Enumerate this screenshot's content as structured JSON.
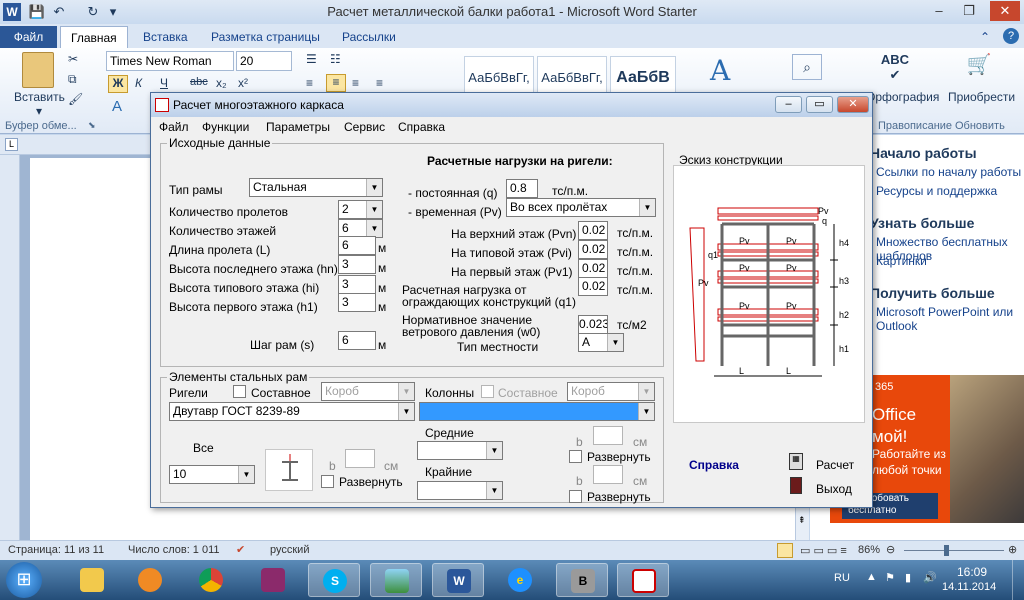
{
  "word": {
    "title": "Расчет металлической балки работа1  -  Microsoft Word Starter",
    "tabs": [
      "Файл",
      "Главная",
      "Вставка",
      "Разметка страницы",
      "Рассылки"
    ],
    "font_name": "Times New Roman",
    "font_size": "20",
    "format_buttons": [
      "Ж",
      "К",
      "Ч",
      "abc",
      "x₂",
      "x²"
    ],
    "styles": [
      "АаБбВвГг,",
      "АаБбВвГг,",
      "АаБбВ"
    ],
    "paste_label": "Вставить",
    "spelling_label": "Орфография",
    "buy_label": "Приобрести",
    "groups": [
      "Буфер обме...",
      "Правописание",
      "Обновить"
    ],
    "status": {
      "page": "Страница: 11 из 11",
      "words": "Число слов: 1 011",
      "lang": "русский",
      "zoom": "86%"
    },
    "panel": {
      "h1": "Начало работы",
      "l1": "Ссылки по началу работы",
      "l2": "Ресурсы и поддержка",
      "h2": "Узнать больше",
      "l3": "Множество бесплатных шаблонов",
      "l4": "Картинки",
      "h3": "Получить больше",
      "l5": "Microsoft PowerPoint или Outlook",
      "ad_year": "365",
      "ad_line1": "Office",
      "ad_line2": "мой!",
      "ad_line3": "Работайте из",
      "ad_line4": "любой точки",
      "ad_btn1": "Попробовать",
      "ad_btn2": "бесплатно"
    }
  },
  "taskbar": {
    "lang": "RU",
    "time": "16:09",
    "date": "14.11.2014"
  },
  "dialog": {
    "title": "Расчет многоэтажного каркаса",
    "menu": [
      "Файл",
      "Функции",
      "Параметры",
      "Сервис",
      "Справка"
    ],
    "input_group": "Исходные данные",
    "frame_type_label": "Тип рамы",
    "frame_type": "Стальная",
    "spans_label": "Количество пролетов",
    "spans": "2",
    "floors_label": "Количество этажей",
    "floors": "6",
    "span_len_label": "Длина пролета (L)",
    "span_len": "6",
    "top_height_label": "Высота последнего этажа (hn)",
    "top_height": "3",
    "typ_height_label": "Высота типового этажа (hi)",
    "typ_height": "3",
    "first_height_label": "Высота первого этажа (h1)",
    "first_height": "3",
    "step_label": "Шаг рам (s)",
    "step": "6",
    "unit_m": "м",
    "loads_title": "Расчетные нагрузки на ригели:",
    "perm_label": "- постоянная (q)",
    "perm": "0.8",
    "perm_unit": "тс/п.м.",
    "temp_label": "- временная (Pv)",
    "temp": "Во всех пролётах",
    "pvn_label": "На верхний этаж (Pvn)",
    "pvn": "0.02",
    "pvi_label": "На типовой этаж (Pvi)",
    "pvi": "0.02",
    "pv1_label": "На первый этаж (Pv1)",
    "pv1": "0.02",
    "tspm": "тс/п.м.",
    "q1_label1": "Расчетная нагрузка от",
    "q1_label2": "ограждающих конструкций (q1)",
    "q1": "0.02",
    "w0_label1": "Нормативное значение",
    "w0_label2": "ветрового давления (w0)",
    "w0": "0.023",
    "w0_unit": "тс/м2",
    "terrain_label": "Тип местности",
    "terrain": "A",
    "sketch_label": "Эскиз конструкции",
    "elements_group": "Элементы стальных рам",
    "beams_label": "Ригели",
    "composite_label": "Составное",
    "box_label": "Короб",
    "columns_label": "Колонны",
    "beam_profile": "Двутавр ГОСТ 8239-89",
    "all_label": "Все",
    "all_value": "10",
    "b_label": "b",
    "cm_label": "см",
    "expand_label": "Развернуть",
    "middle_label": "Средние",
    "edge_label": "Крайние",
    "help_label": "Справка",
    "calc_label": "Расчет",
    "exit_label": "Выход",
    "sketch_marks": {
      "pv": "Pv",
      "q": "q",
      "q1": "q1",
      "L": "L",
      "h4": "h4",
      "h3": "h3",
      "h2": "h2",
      "h1": "h1"
    }
  }
}
